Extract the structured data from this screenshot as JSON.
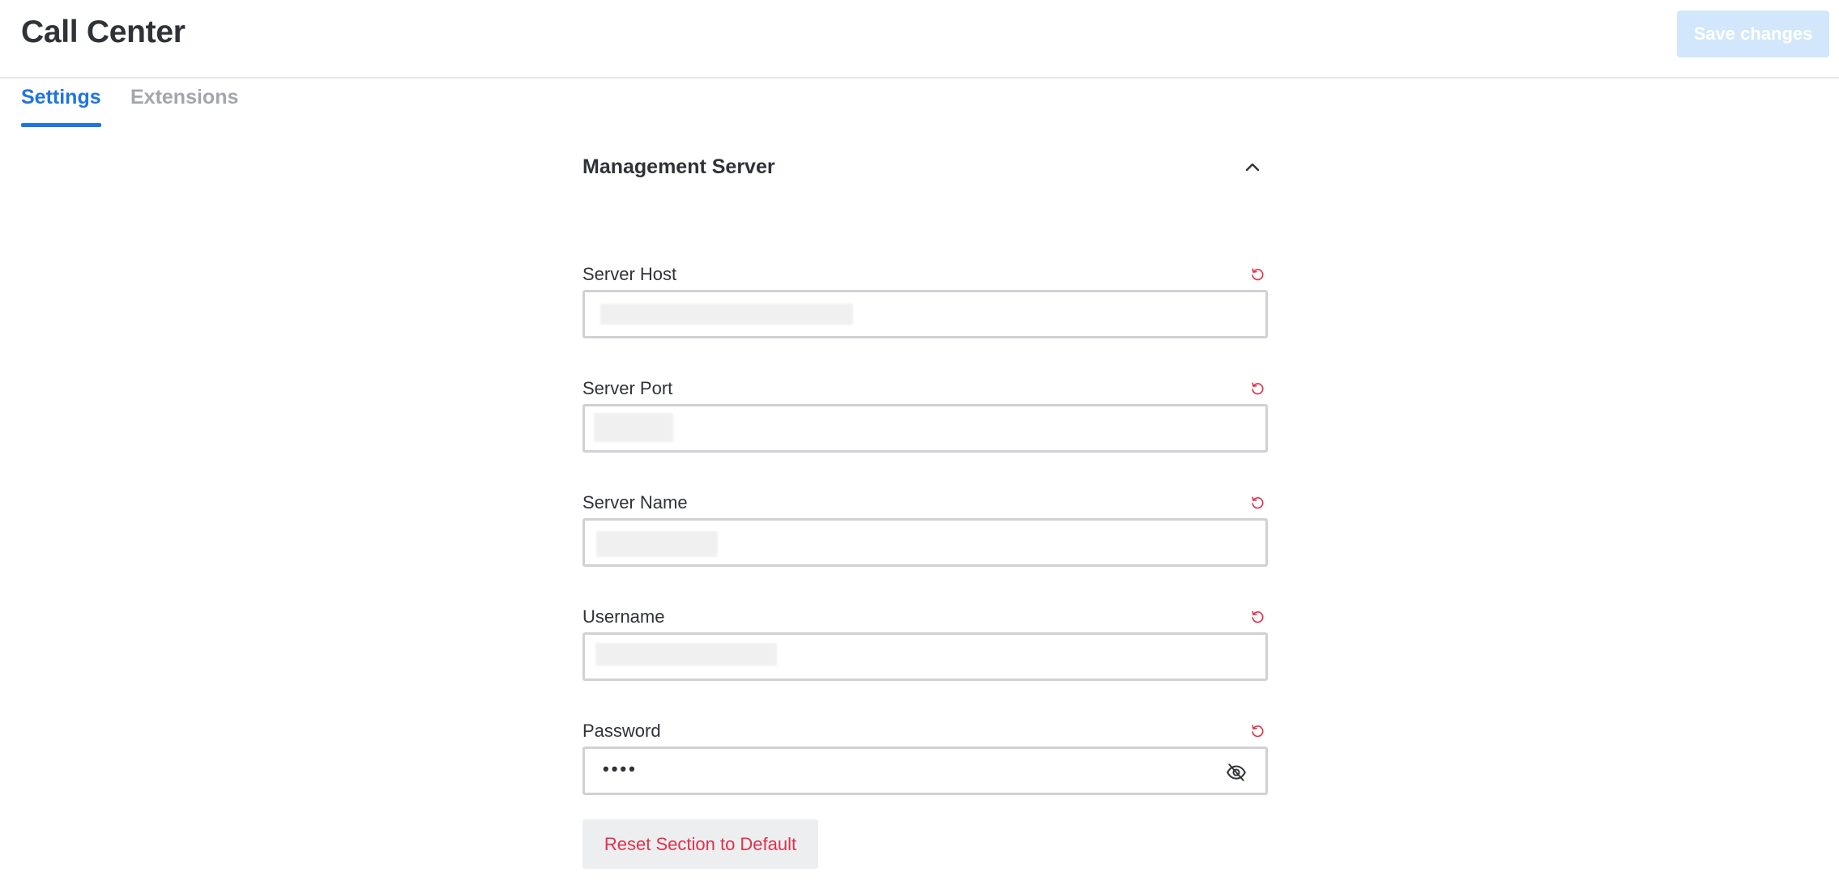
{
  "header": {
    "title": "Call Center",
    "save_label": "Save changes"
  },
  "tabs": [
    {
      "label": "Settings",
      "active": true
    },
    {
      "label": "Extensions",
      "active": false
    }
  ],
  "section": {
    "title": "Management Server",
    "collapse_icon": "chevron-up-icon",
    "fields": [
      {
        "label": "Server Host",
        "type": "text",
        "reset_icon": "reset-icon"
      },
      {
        "label": "Server Port",
        "type": "text",
        "reset_icon": "reset-icon"
      },
      {
        "label": "Server Name",
        "type": "text",
        "reset_icon": "reset-icon"
      },
      {
        "label": "Username",
        "type": "text",
        "reset_icon": "reset-icon"
      },
      {
        "label": "Password",
        "type": "password",
        "value": "••••",
        "reset_icon": "reset-icon",
        "toggle_icon": "eye-off-icon"
      }
    ],
    "reset_section_label": "Reset Section to Default"
  },
  "colors": {
    "accent": "#1f75e0",
    "danger": "#e0314b",
    "save_disabled_bg": "#d2e7fb"
  }
}
